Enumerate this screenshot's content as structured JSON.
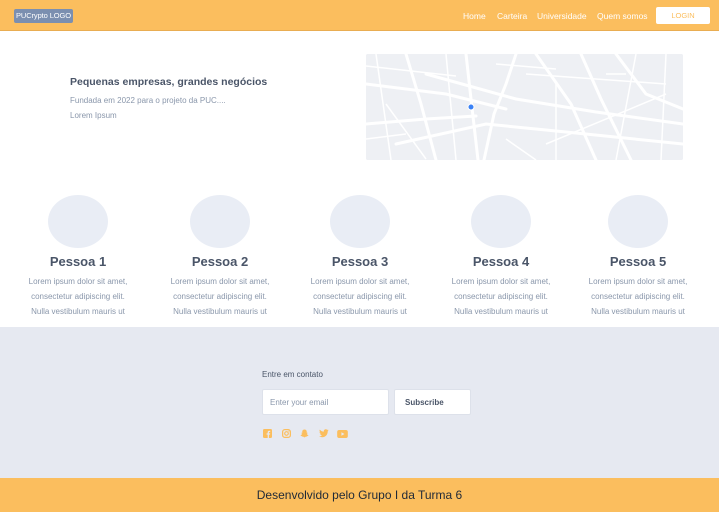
{
  "header": {
    "logo": "PUCrypto LOGO",
    "nav": [
      "Home",
      "Carteira",
      "Universidade",
      "Quem somos"
    ],
    "login_label": "LOGIN"
  },
  "hero": {
    "title": "Pequenas empresas, grandes negócios",
    "subtitle": "Fundada em 2022 para o projeto da PUC....",
    "lorem": "Lorem Ipsum"
  },
  "people": [
    {
      "name": "Pessoa 1",
      "desc": [
        "Lorem ipsum dolor sit amet,",
        "consectetur adipiscing elit.",
        "Nulla vestibulum mauris ut"
      ]
    },
    {
      "name": "Pessoa 2",
      "desc": [
        "Lorem ipsum dolor sit amet,",
        "consectetur adipiscing elit.",
        "Nulla vestibulum mauris ut"
      ]
    },
    {
      "name": "Pessoa 3",
      "desc": [
        "Lorem ipsum dolor sit amet,",
        "consectetur adipiscing elit.",
        "Nulla vestibulum mauris ut"
      ]
    },
    {
      "name": "Pessoa 4",
      "desc": [
        "Lorem ipsum dolor sit amet,",
        "consectetur adipiscing elit.",
        "Nulla vestibulum mauris ut"
      ]
    },
    {
      "name": "Pessoa 5",
      "desc": [
        "Lorem ipsum dolor sit amet,",
        "consectetur adipiscing elit.",
        "Nulla vestibulum mauris ut"
      ]
    }
  ],
  "contact": {
    "label": "Entre em contato",
    "email_placeholder": "Enter your email",
    "subscribe_label": "Subscribe",
    "social_icons": [
      "facebook-icon",
      "instagram-icon",
      "snapchat-icon",
      "twitter-icon",
      "youtube-icon"
    ]
  },
  "footer": {
    "text": "Desenvolvido pelo Grupo I da Turma 6"
  },
  "colors": {
    "accent": "#fbbe5e",
    "footer_bg": "#e6e9f1",
    "text": "#4a5568",
    "muted_text": "#8a97ab"
  }
}
